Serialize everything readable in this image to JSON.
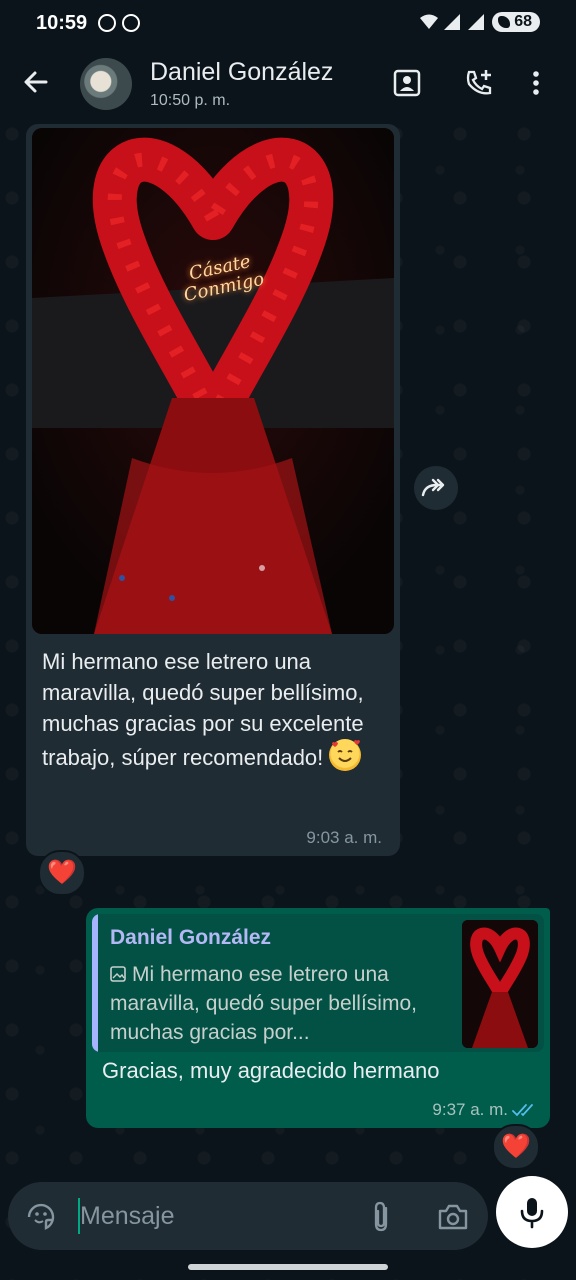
{
  "status_bar": {
    "time": "10:59",
    "battery": "68"
  },
  "header": {
    "contact_name": "Daniel González",
    "last_seen": "10:50 p. m."
  },
  "messages": {
    "incoming": {
      "image_label": "Cásate Conmigo",
      "text": "Mi hermano ese letrero una maravilla, quedó super bellísimo, muchas gracias por su excelente trabajo, súper recomendado!",
      "time": "9:03 a. m.",
      "reaction": "❤️"
    },
    "outgoing": {
      "quote_author": "Daniel González",
      "quote_text": "Mi hermano ese letrero una maravilla, quedó super bellísimo, muchas gracias por...",
      "text": "Gracias, muy agradecido hermano",
      "time": "9:37 a. m.",
      "reaction": "❤️"
    }
  },
  "composer": {
    "placeholder": "Mensaje"
  },
  "colors": {
    "background": "#0b141a",
    "incoming_bubble": "#202c33",
    "outgoing_bubble": "#005c4b",
    "quote_accent": "#a5b4fc",
    "read_ticks": "#53bdeb"
  }
}
